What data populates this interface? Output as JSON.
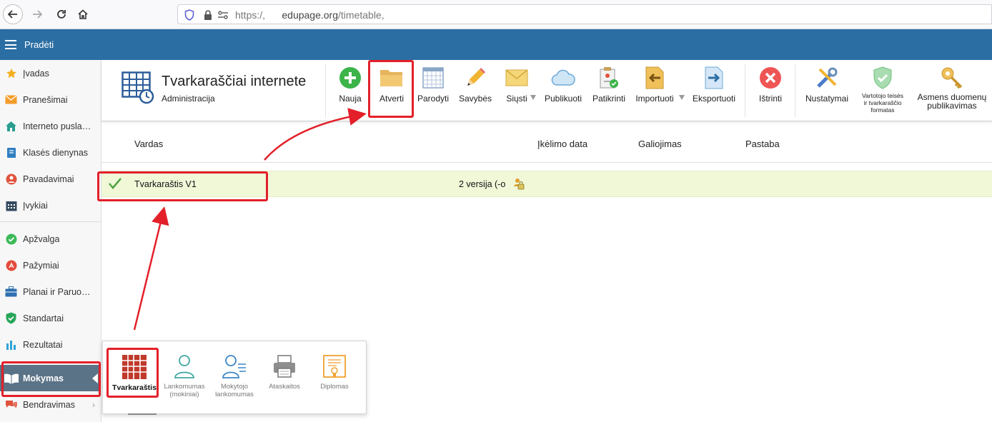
{
  "browser": {
    "url_prefix": "https:/,",
    "url_domain": "edupage.org",
    "url_path": "/timetable,"
  },
  "topbar": {
    "title": "Pradėti"
  },
  "sidebar": {
    "items": [
      {
        "label": "Įvadas",
        "icon": "star-icon"
      },
      {
        "label": "Pranešimai",
        "icon": "envelope-icon"
      },
      {
        "label": "Interneto puslapis",
        "icon": "house-icon"
      },
      {
        "label": "Klasės dienynas",
        "icon": "book-icon"
      },
      {
        "label": "Pavadavimai",
        "icon": "person-icon"
      },
      {
        "label": "Įvykiai",
        "icon": "calendar-icon"
      },
      {
        "label": "Apžvalga",
        "icon": "check-circle-icon"
      },
      {
        "label": "Pažymiai",
        "icon": "grade-circle-icon"
      },
      {
        "label": "Planai ir Paruošimas",
        "icon": "briefcase-icon"
      },
      {
        "label": "Standartai",
        "icon": "shield-check-icon"
      },
      {
        "label": "Rezultatai",
        "icon": "bar-chart-icon"
      },
      {
        "label": "Mokymas",
        "icon": "open-book-icon"
      },
      {
        "label": "Bendravimas",
        "icon": "chat-icon"
      }
    ]
  },
  "header": {
    "title": "Tvarkaraščiai internete",
    "subtitle": "Administracija"
  },
  "toolbar": {
    "naujа": "Nauja",
    "atverti": "Atverti",
    "parodyti": "Parodyti",
    "savybes": "Savybės",
    "siusti": "Siųsti",
    "publikuoti": "Publikuoti",
    "patikrinti": "Patikrinti",
    "importuoti": "Importuoti",
    "eksportuoti": "Eksportuoti",
    "istrinti": "Ištrinti",
    "nustatymai": "Nustatymai",
    "vartotojo_1": "Vartotojo teisės",
    "vartotojo_2": "ir tvarkaraščio",
    "vartotojo_3": "formatas",
    "asmens_1": "Asmens duomenų",
    "asmens_2": "publikavimas"
  },
  "table": {
    "columns": [
      "Vardas",
      "Įkėlimo data",
      "Galiojimas",
      "Pastaba"
    ],
    "rows": [
      {
        "name": "Tvarkaraštis V1",
        "version": "2 versija (-o"
      }
    ]
  },
  "popup": {
    "items": [
      {
        "label": "Tvarkaraštis"
      },
      {
        "label1": "Lankomumas",
        "label2": "(mokiniai)"
      },
      {
        "label1": "Mokytojo",
        "label2": "lankomumas"
      },
      {
        "label": "Ataskaitos"
      },
      {
        "label": "Diplomas"
      }
    ]
  },
  "colors": {
    "topbar": "#2b6ea3",
    "selected_row": "#f0f8d8",
    "highlight": "#e3202a",
    "sidebar_active": "#5b7387"
  }
}
